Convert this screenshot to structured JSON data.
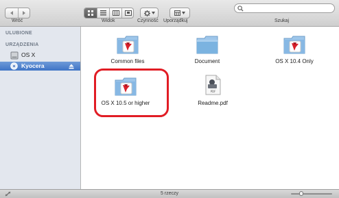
{
  "toolbar": {
    "back_label": "Wróć",
    "view_label": "Widok",
    "action_label": "Czynność",
    "arrange_label": "Uporządkuj",
    "search_label": "Szukaj",
    "search_value": ""
  },
  "sidebar": {
    "favorites_header": "ULUBIONE",
    "devices_header": "URZĄDZENIA",
    "devices": [
      {
        "label": "OS X",
        "icon": "hard-drive-icon",
        "selected": false
      },
      {
        "label": "Kyocera",
        "icon": "disk-icon",
        "selected": true,
        "eject": "eject-icon"
      }
    ]
  },
  "files": [
    {
      "label": "Common files",
      "icon": "kyocera-folder-icon"
    },
    {
      "label": "Document",
      "icon": "folder-icon"
    },
    {
      "label": "OS X 10.4 Only",
      "icon": "kyocera-folder-icon"
    },
    {
      "label": "OS X 10.5 or higher",
      "icon": "kyocera-folder-icon",
      "highlighted": true
    },
    {
      "label": "Readme.pdf",
      "icon": "pdf-document-icon"
    }
  ],
  "status": {
    "count_text": "5 rzeczy"
  },
  "colors": {
    "highlight": "#e11c24",
    "selection": "#3f74c6",
    "folder": "#7bb3e0",
    "kyocera_red": "#d8202a"
  }
}
